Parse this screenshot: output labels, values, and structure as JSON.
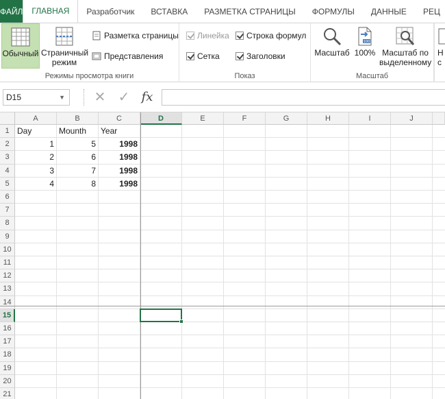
{
  "tabs": [
    {
      "label": "ФАЙЛ"
    },
    {
      "label": "ГЛАВНАЯ"
    },
    {
      "label": "Разработчик"
    },
    {
      "label": "ВСТАВКА"
    },
    {
      "label": "РАЗМЕТКА СТРАНИЦЫ"
    },
    {
      "label": "ФОРМУЛЫ"
    },
    {
      "label": "ДАННЫЕ"
    },
    {
      "label": "РЕЦ"
    }
  ],
  "ribbon": {
    "views": {
      "group_label": "Режимы просмотра книги",
      "normal_label": "Обычный",
      "page_mode_line1": "Страничный",
      "page_mode_line2": "режим",
      "page_layout_label": "Разметка страницы",
      "custom_views_label": "Представления"
    },
    "show": {
      "group_label": "Показ",
      "ruler_label": "Линейка",
      "formula_bar_label": "Строка формул",
      "gridlines_label": "Сетка",
      "headings_label": "Заголовки"
    },
    "zoom": {
      "group_label": "Масштаб",
      "zoom_label": "Масштаб",
      "zoom100_label": "100%",
      "zoom_sel_line1": "Масштаб по",
      "zoom_sel_line2": "выделенному",
      "zoom_icon_badge": "100",
      "next_line1": "Н",
      "next_line2": "с"
    }
  },
  "formula_bar": {
    "name_box": "D15",
    "fx_label": "fx",
    "value": ""
  },
  "grid": {
    "columns": [
      "A",
      "B",
      "C",
      "D",
      "E",
      "F",
      "G",
      "H",
      "I",
      "J"
    ],
    "selected_column": "D",
    "rows": [
      "1",
      "2",
      "3",
      "4",
      "5",
      "6",
      "7",
      "8",
      "9",
      "10",
      "11",
      "12",
      "13",
      "14",
      "15",
      "16",
      "17",
      "18",
      "19",
      "20",
      "21"
    ],
    "selected_row": "15",
    "cells": [
      {
        "ref": "A1",
        "value": "Day"
      },
      {
        "ref": "B1",
        "value": "Mounth"
      },
      {
        "ref": "C1",
        "value": "Year"
      },
      {
        "ref": "A2",
        "value": "1"
      },
      {
        "ref": "B2",
        "value": "5"
      },
      {
        "ref": "C2",
        "value": "1998"
      },
      {
        "ref": "A3",
        "value": "2"
      },
      {
        "ref": "B3",
        "value": "6"
      },
      {
        "ref": "C3",
        "value": "1998"
      },
      {
        "ref": "A4",
        "value": "3"
      },
      {
        "ref": "B4",
        "value": "7"
      },
      {
        "ref": "C4",
        "value": "1998"
      },
      {
        "ref": "A5",
        "value": "4"
      },
      {
        "ref": "B5",
        "value": "8"
      },
      {
        "ref": "C5",
        "value": "1998"
      }
    ],
    "active_cell": "D15"
  },
  "colors": {
    "accent": "#217346",
    "selected_view": "#c5e0b3"
  }
}
